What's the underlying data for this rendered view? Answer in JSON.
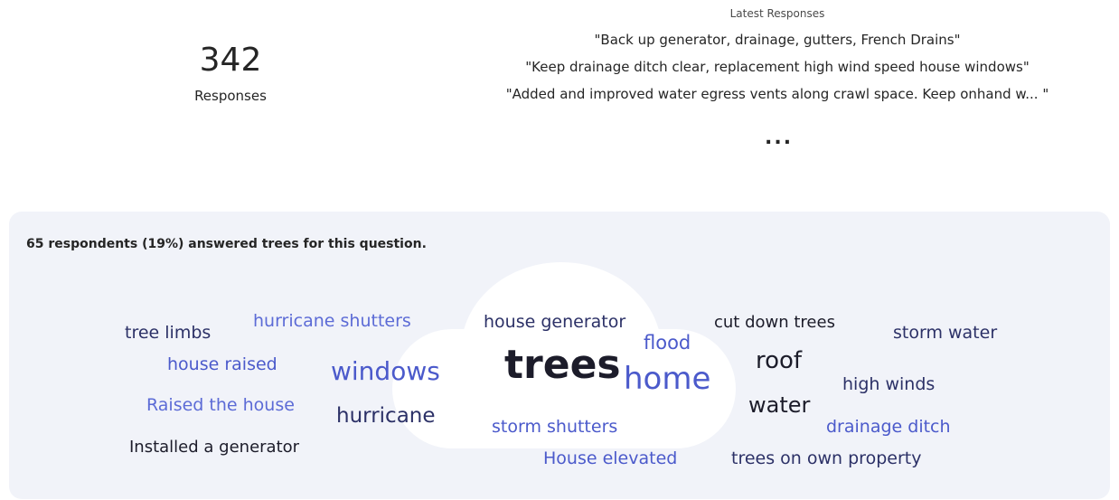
{
  "summary": {
    "count": "342",
    "count_label": "Responses"
  },
  "latest": {
    "title": "Latest Responses",
    "items": [
      "\"Back up generator, drainage, gutters, French Drains\"",
      "\"Keep drainage ditch clear, replacement high wind speed house windows\"",
      "\"Added and improved water egress vents along crawl space. Keep onhand w...  \""
    ],
    "more": "..."
  },
  "cloud_panel": {
    "caption": "65 respondents (19%) answered trees for this question.",
    "words": {
      "trees": "trees",
      "home": "home",
      "windows": "windows",
      "roof": "roof",
      "water": "water",
      "hurricane": "hurricane",
      "house_generator": "house generator",
      "flood": "flood",
      "cut_down_trees": "cut down trees",
      "storm_water": "storm water",
      "hurricane_shutters": "hurricane shutters",
      "tree_limbs": "tree limbs",
      "house_raised": "house raised",
      "raised_the_house": "Raised the house",
      "installed_a_generator": "Installed a generator",
      "storm_shutters": "storm shutters",
      "house_elevated": "House elevated",
      "trees_on_own_property": "trees on own property",
      "high_winds": "high winds",
      "drainage_ditch": "drainage ditch"
    }
  }
}
